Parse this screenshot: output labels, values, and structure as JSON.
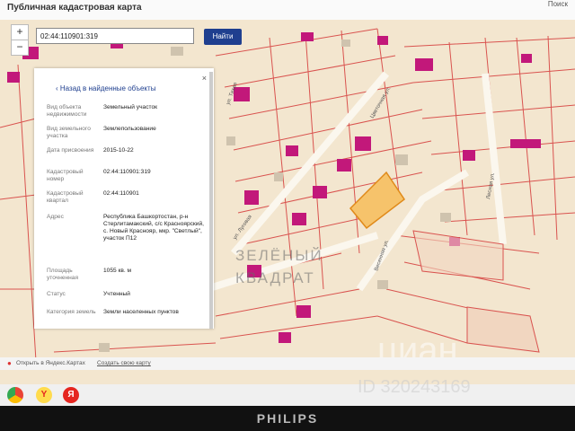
{
  "app": {
    "title": "Публичная кадастровая карта",
    "topbar_right": "Поиск"
  },
  "search": {
    "value": "02:44:110901:319",
    "button": "Найти"
  },
  "zoom": {
    "in": "+",
    "out": "−"
  },
  "panel": {
    "back_label": "Назад в найденные объекты",
    "close": "×",
    "rows": [
      {
        "label": "Вид объекта недвижимости",
        "value": "Земельный участок"
      },
      {
        "label": "Вид земельного участка",
        "value": "Землепользование"
      },
      {
        "label": "Дата присвоения",
        "value": "2015-10-22"
      },
      {
        "label": "Кадастровый номер",
        "value": "02:44:110901:319"
      },
      {
        "label": "Кадастровый квартал",
        "value": "02:44:110901"
      },
      {
        "label": "Адрес",
        "value": "Республика Башкортостан, р-н Стерлитамакский, с/с Красноярский, с. Новый Краснояр, мкр. \"Светлый\", участок П12"
      },
      {
        "label": "Площадь уточненная",
        "value": "1055 кв. м"
      },
      {
        "label": "Статус",
        "value": "Учтенный"
      },
      {
        "label": "Категория земель",
        "value": "Земли населенных пунктов"
      }
    ]
  },
  "map": {
    "street_labels": [
      "ул. Луговая",
      "ул. Тихая",
      "Цветочная ул.",
      "Весенняя ул.",
      "Лесная ул."
    ],
    "bg_color": "#f3e6cf",
    "building_color": "#c2187a",
    "parcel_line": "#d9534f",
    "selected_fill": "#f6c36b"
  },
  "status": {
    "open_yandex": "Открыть в Яндекс.Картах",
    "feedback": "Создать свою карту"
  },
  "watermarks": {
    "line1": "ЗЕЛЁНЫЙ",
    "line2": "КВАДРАТ",
    "cian": "циан",
    "id": "ID 320243169"
  },
  "taskbar": {
    "icons": [
      "chrome-icon",
      "yandex-browser-icon",
      "yandex-icon"
    ],
    "yandex_letter": "Я"
  },
  "monitor": {
    "brand": "PHILIPS"
  }
}
